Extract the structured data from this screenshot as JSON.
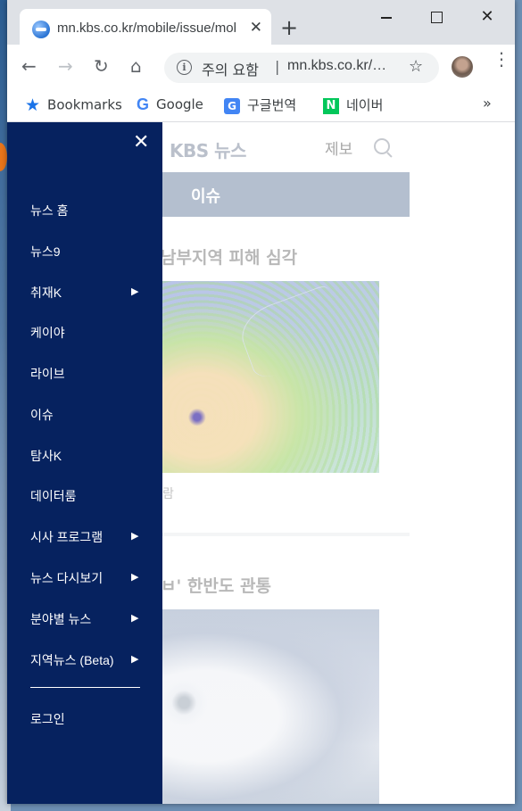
{
  "browser": {
    "tab_title": "mn.kbs.co.kr/mobile/issue/mobile_issue.html",
    "tab_close": "✕",
    "new_tab": "+",
    "security_warning": "주의 요함",
    "separator": "|",
    "url": "mn.kbs.co.kr/…",
    "bookmarks": [
      {
        "label": "Bookmarks",
        "icon": "star-icon"
      },
      {
        "label": "Google",
        "icon": "google-icon"
      },
      {
        "label": "구글번역",
        "icon": "google-translate-icon"
      },
      {
        "label": "네이버",
        "icon": "naver-icon"
      }
    ],
    "bookmarks_more": "»"
  },
  "site": {
    "logo": "KBS 뉴스",
    "report_label": "제보",
    "section_title": "이슈",
    "headline1": "남부지역 피해 심각",
    "caption1": "람",
    "headline2": "ㅂ' 한반도 관통"
  },
  "drawer": {
    "close": "✕",
    "items": [
      {
        "label": "뉴스 홈",
        "has_submenu": false
      },
      {
        "label": "뉴스9",
        "has_submenu": false
      },
      {
        "label": "취재K",
        "has_submenu": true
      },
      {
        "label": "케이야",
        "has_submenu": false
      },
      {
        "label": "라이브",
        "has_submenu": false
      },
      {
        "label": "이슈",
        "has_submenu": false
      },
      {
        "label": "탐사K",
        "has_submenu": false
      },
      {
        "label": "데이터룸",
        "has_submenu": false
      },
      {
        "label": "시사 프로그램",
        "has_submenu": true
      },
      {
        "label": "뉴스 다시보기",
        "has_submenu": true
      },
      {
        "label": "분야별 뉴스",
        "has_submenu": true
      },
      {
        "label": "지역뉴스 (Beta)",
        "has_submenu": true
      }
    ],
    "arrow": "▶",
    "login": "로그인"
  },
  "colors": {
    "drawer_bg": "#06225f",
    "section_bar": "#b4bfcf",
    "titlebar": "#dee1e6"
  }
}
